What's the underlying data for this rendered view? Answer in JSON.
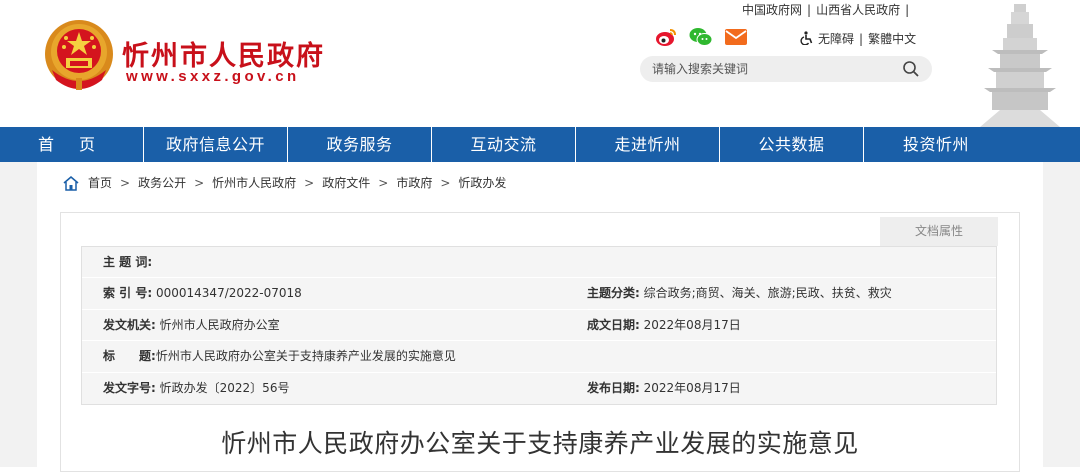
{
  "site": {
    "title": "忻州市人民政府",
    "url": "www.sxxz.gov.cn"
  },
  "top_links": [
    "中国政府网",
    "山西省人民政府"
  ],
  "accessibility": {
    "barrier_free": "无障碍",
    "traditional": "繁體中文"
  },
  "search": {
    "placeholder": "请输入搜索关键词"
  },
  "nav": [
    "首 页",
    "政府信息公开",
    "政务服务",
    "互动交流",
    "走进忻州",
    "公共数据",
    "投资忻州"
  ],
  "breadcrumb": [
    "首页",
    "政务公开",
    "忻州市人民政府",
    "政府文件",
    "市政府",
    "忻政办发"
  ],
  "doc_tab": "文档属性",
  "meta": {
    "subject_label": "主 题 词:",
    "subject_value": "",
    "index_label": "索 引 号:",
    "index_value": "000014347/2022-07018",
    "category_label": "主题分类:",
    "category_value": "综合政务;商贸、海关、旅游;民政、扶贫、救灾",
    "issuer_label": "发文机关:",
    "issuer_value": "忻州市人民政府办公室",
    "created_label": "成文日期:",
    "created_value": "2022年08月17日",
    "title_label": "标　　题:",
    "title_value": "忻州市人民政府办公室关于支持康养产业发展的实施意见",
    "docno_label": "发文字号:",
    "docno_value": "忻政办发〔2022〕56号",
    "published_label": "发布日期:",
    "published_value": "2022年08月17日"
  },
  "doc_title": "忻州市人民政府办公室关于支持康养产业发展的实施意见",
  "colors": {
    "brand_red": "#c8101a",
    "nav_blue": "#1a5fa8",
    "meta_bg": "#f5f5f5"
  },
  "icons": [
    "national-emblem-icon",
    "weibo-icon",
    "wechat-icon",
    "mail-icon",
    "accessibility-icon",
    "search-icon",
    "home-icon",
    "pagoda-icon"
  ]
}
